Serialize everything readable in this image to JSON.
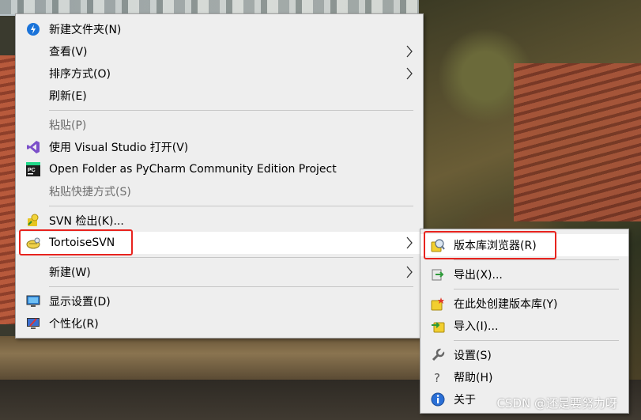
{
  "main_menu": {
    "items": [
      {
        "label": "新建文件夹(N)",
        "icon": "new-folder-icon"
      },
      {
        "label": "查看(V)"
      },
      {
        "label": "排序方式(O)"
      },
      {
        "label": "刷新(E)"
      },
      {
        "label": "粘贴(P)"
      },
      {
        "label": "使用 Visual Studio 打开(V)",
        "icon": "visual-studio-icon"
      },
      {
        "label": "Open Folder as PyCharm Community Edition Project",
        "icon": "pycharm-icon"
      },
      {
        "label": "粘贴快捷方式(S)"
      },
      {
        "label": "SVN 检出(K)...",
        "icon": "svn-checkout-icon"
      },
      {
        "label": "TortoiseSVN",
        "icon": "tortoisesvn-icon"
      },
      {
        "label": "新建(W)"
      },
      {
        "label": "显示设置(D)",
        "icon": "display-settings-icon"
      },
      {
        "label": "个性化(R)",
        "icon": "personalize-icon"
      }
    ]
  },
  "sub_menu": {
    "items": [
      {
        "label": "版本库浏览器(R)",
        "icon": "repo-browser-icon"
      },
      {
        "label": "导出(X)...",
        "icon": "export-icon"
      },
      {
        "label": "在此处创建版本库(Y)",
        "icon": "create-repo-icon"
      },
      {
        "label": "导入(I)...",
        "icon": "import-icon"
      },
      {
        "label": "设置(S)",
        "icon": "settings-icon"
      },
      {
        "label": "帮助(H)",
        "icon": "help-icon"
      },
      {
        "label": "关于",
        "icon": "about-icon"
      }
    ]
  },
  "watermark": "CSDN @还是要努力呀",
  "colors": {
    "menu_bg": "#eeeeee",
    "hover_bg": "#ffffff",
    "highlight_border": "#e8231e",
    "disabled_text": "#6d6d6d"
  }
}
